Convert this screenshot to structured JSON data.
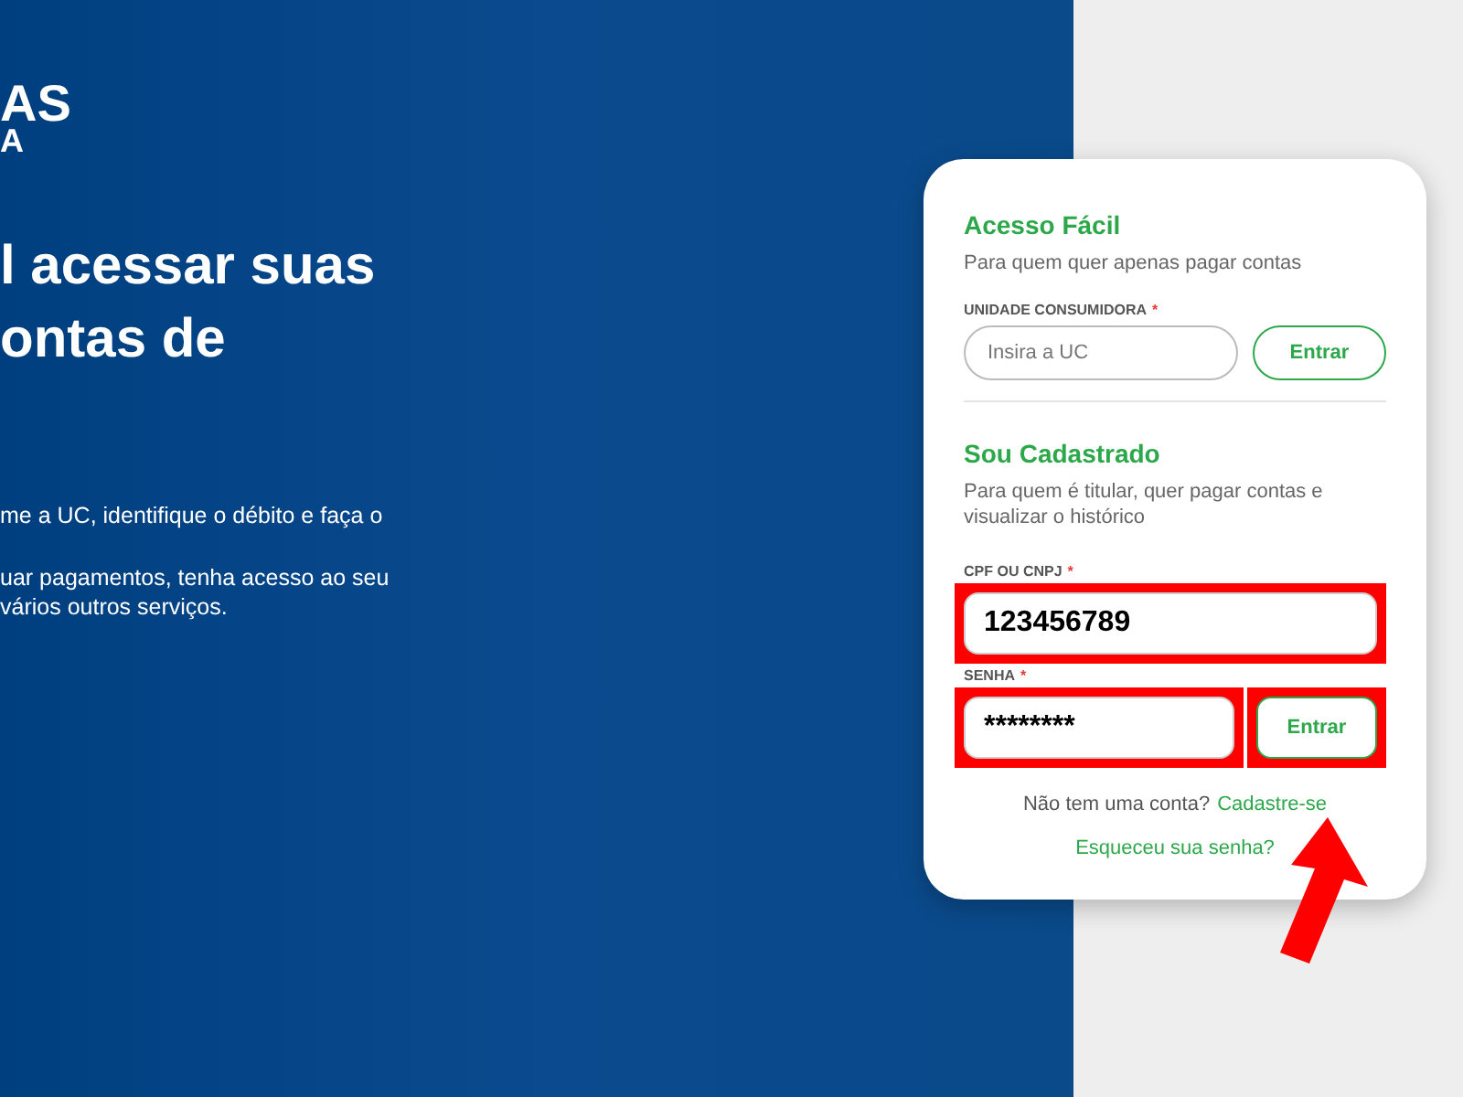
{
  "logo": {
    "lines": [
      "AS",
      "A"
    ]
  },
  "hero": {
    "heading_lines": [
      "l acessar suas",
      "ontas de"
    ],
    "paragraphs": [
      "me a UC, identifique o débito e faça o",
      "uar pagamentos, tenha acesso ao seu\nvários outros serviços."
    ]
  },
  "quick_access": {
    "title": "Acesso Fácil",
    "subtitle": "Para quem quer apenas pagar contas",
    "field": {
      "label": "UNIDADE CONSUMIDORA",
      "required_mark": "*",
      "placeholder": "Insira a UC"
    },
    "button": "Entrar"
  },
  "registered": {
    "title": "Sou Cadastrado",
    "subtitle": "Para quem é titular, quer pagar contas e visualizar o histórico",
    "document_field": {
      "label": "CPF OU CNPJ",
      "required_mark": "*",
      "value": "123456789"
    },
    "password_field": {
      "label": "SENHA",
      "required_mark": "*",
      "value": "********"
    },
    "button": "Entrar"
  },
  "signup": {
    "prompt": "Não tem uma conta?",
    "link": "Cadastre-se"
  },
  "forgot_link": "Esqueceu sua senha?"
}
